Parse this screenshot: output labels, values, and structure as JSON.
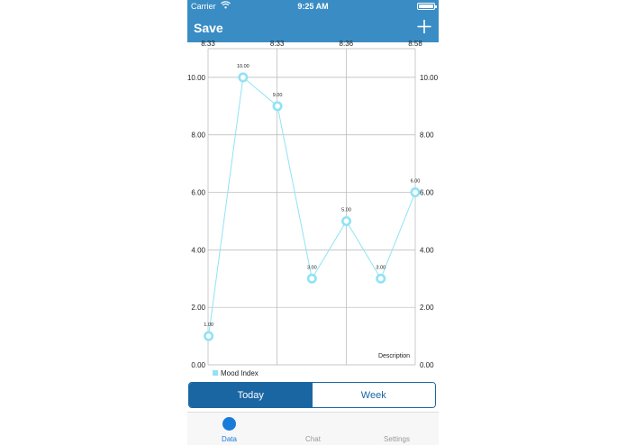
{
  "status_bar": {
    "carrier": "Carrier",
    "time": "9:25 AM",
    "wifi_icon": "wifi-icon",
    "battery_icon": "battery-icon"
  },
  "nav_bar": {
    "title": "Save",
    "add_icon": "plus-icon"
  },
  "chart_data": {
    "type": "line",
    "x_tick_labels_top": [
      "8:33",
      "8:33",
      "8:36",
      "8:58"
    ],
    "y_tick_labels": [
      "0.00",
      "2.00",
      "4.00",
      "6.00",
      "8.00",
      "10.00"
    ],
    "ylim": [
      0,
      11
    ],
    "series": [
      {
        "name": "Mood Index",
        "color": "#8fe3f5",
        "values": [
          1,
          10,
          9,
          3,
          5,
          3,
          6
        ],
        "value_labels": [
          "1.00",
          "10.00",
          "9.00",
          "3.00",
          "5.00",
          "3.00",
          "6.00"
        ]
      }
    ],
    "description": "Description",
    "legend_position": "bottom-left",
    "grid": true
  },
  "segmented_control": {
    "options": [
      "Today",
      "Week"
    ],
    "selected": "Today",
    "active_color": "#1a66a3"
  },
  "tab_bar": {
    "items": [
      {
        "label": "Data",
        "active": true
      },
      {
        "label": "Chat",
        "active": false
      },
      {
        "label": "Settings",
        "active": false
      }
    ]
  },
  "colors": {
    "brand": "#3a8dc4",
    "line": "#8fe3f5",
    "tab_active": "#1a7ad8"
  }
}
